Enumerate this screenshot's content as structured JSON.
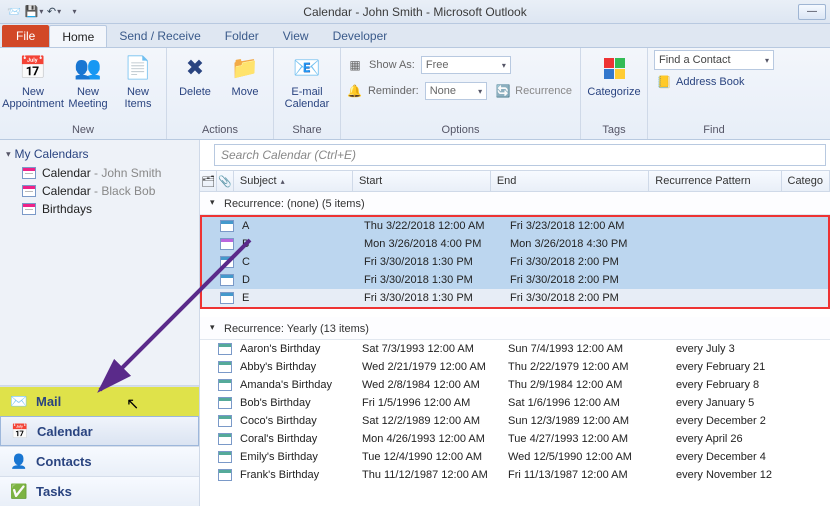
{
  "title": "Calendar - John Smith  -  Microsoft Outlook",
  "tabs": {
    "file": "File",
    "home": "Home",
    "sendreceive": "Send / Receive",
    "folder": "Folder",
    "view": "View",
    "developer": "Developer"
  },
  "ribbon": {
    "new": {
      "appointment": "New Appointment",
      "meeting": "New Meeting",
      "items": "New Items",
      "label": "New"
    },
    "actions": {
      "delete": "Delete",
      "move": "Move",
      "label": "Actions"
    },
    "share": {
      "email": "E-mail Calendar",
      "label": "Share"
    },
    "options": {
      "showas_label": "Show As:",
      "showas_value": "Free",
      "reminder_label": "Reminder:",
      "reminder_value": "None",
      "recurrence": "Recurrence",
      "label": "Options"
    },
    "tags": {
      "categorize": "Categorize",
      "label": "Tags"
    },
    "find": {
      "contact": "Find a Contact",
      "addressbook": "Address Book",
      "label": "Find"
    }
  },
  "nav": {
    "myCalendars": "My Calendars",
    "items": [
      {
        "label": "Calendar",
        "suffix": " - John Smith"
      },
      {
        "label": "Calendar",
        "suffix": " - Black Bob"
      },
      {
        "label": "Birthdays",
        "suffix": ""
      }
    ],
    "buttons": {
      "mail": "Mail",
      "calendar": "Calendar",
      "contacts": "Contacts",
      "tasks": "Tasks"
    }
  },
  "search": {
    "placeholder": "Search Calendar (Ctrl+E)"
  },
  "columns": {
    "subject": "Subject",
    "start": "Start",
    "end": "End",
    "recurrence": "Recurrence Pattern",
    "categories": "Catego"
  },
  "groups": {
    "none": {
      "header": "Recurrence: (none) (5 items)",
      "rows": [
        {
          "subject": "A",
          "start": "Thu 3/22/2018 12:00 AM",
          "end": "Fri 3/23/2018 12:00 AM"
        },
        {
          "subject": "B",
          "start": "Mon 3/26/2018 4:00 PM",
          "end": "Mon 3/26/2018 4:30 PM"
        },
        {
          "subject": "C",
          "start": "Fri 3/30/2018 1:30 PM",
          "end": "Fri 3/30/2018 2:00 PM"
        },
        {
          "subject": "D",
          "start": "Fri 3/30/2018 1:30 PM",
          "end": "Fri 3/30/2018 2:00 PM"
        },
        {
          "subject": "E",
          "start": "Fri 3/30/2018 1:30 PM",
          "end": "Fri 3/30/2018 2:00 PM"
        }
      ]
    },
    "yearly": {
      "header": "Recurrence: Yearly (13 items)",
      "rows": [
        {
          "subject": "Aaron's Birthday",
          "start": "Sat 7/3/1993 12:00 AM",
          "end": "Sun 7/4/1993 12:00 AM",
          "rec": "every July 3"
        },
        {
          "subject": "Abby's Birthday",
          "start": "Wed 2/21/1979 12:00 AM",
          "end": "Thu 2/22/1979 12:00 AM",
          "rec": "every February 21"
        },
        {
          "subject": "Amanda's Birthday",
          "start": "Wed 2/8/1984 12:00 AM",
          "end": "Thu 2/9/1984 12:00 AM",
          "rec": "every February 8"
        },
        {
          "subject": "Bob's Birthday",
          "start": "Fri 1/5/1996 12:00 AM",
          "end": "Sat 1/6/1996 12:00 AM",
          "rec": "every January 5"
        },
        {
          "subject": "Coco's Birthday",
          "start": "Sat 12/2/1989 12:00 AM",
          "end": "Sun 12/3/1989 12:00 AM",
          "rec": "every December 2"
        },
        {
          "subject": "Coral's Birthday",
          "start": "Mon 4/26/1993 12:00 AM",
          "end": "Tue 4/27/1993 12:00 AM",
          "rec": "every April 26"
        },
        {
          "subject": "Emily's Birthday",
          "start": "Tue 12/4/1990 12:00 AM",
          "end": "Wed 12/5/1990 12:00 AM",
          "rec": "every December 4"
        },
        {
          "subject": "Frank's Birthday",
          "start": "Thu 11/12/1987 12:00 AM",
          "end": "Fri 11/13/1987 12:00 AM",
          "rec": "every November 12"
        }
      ]
    }
  }
}
